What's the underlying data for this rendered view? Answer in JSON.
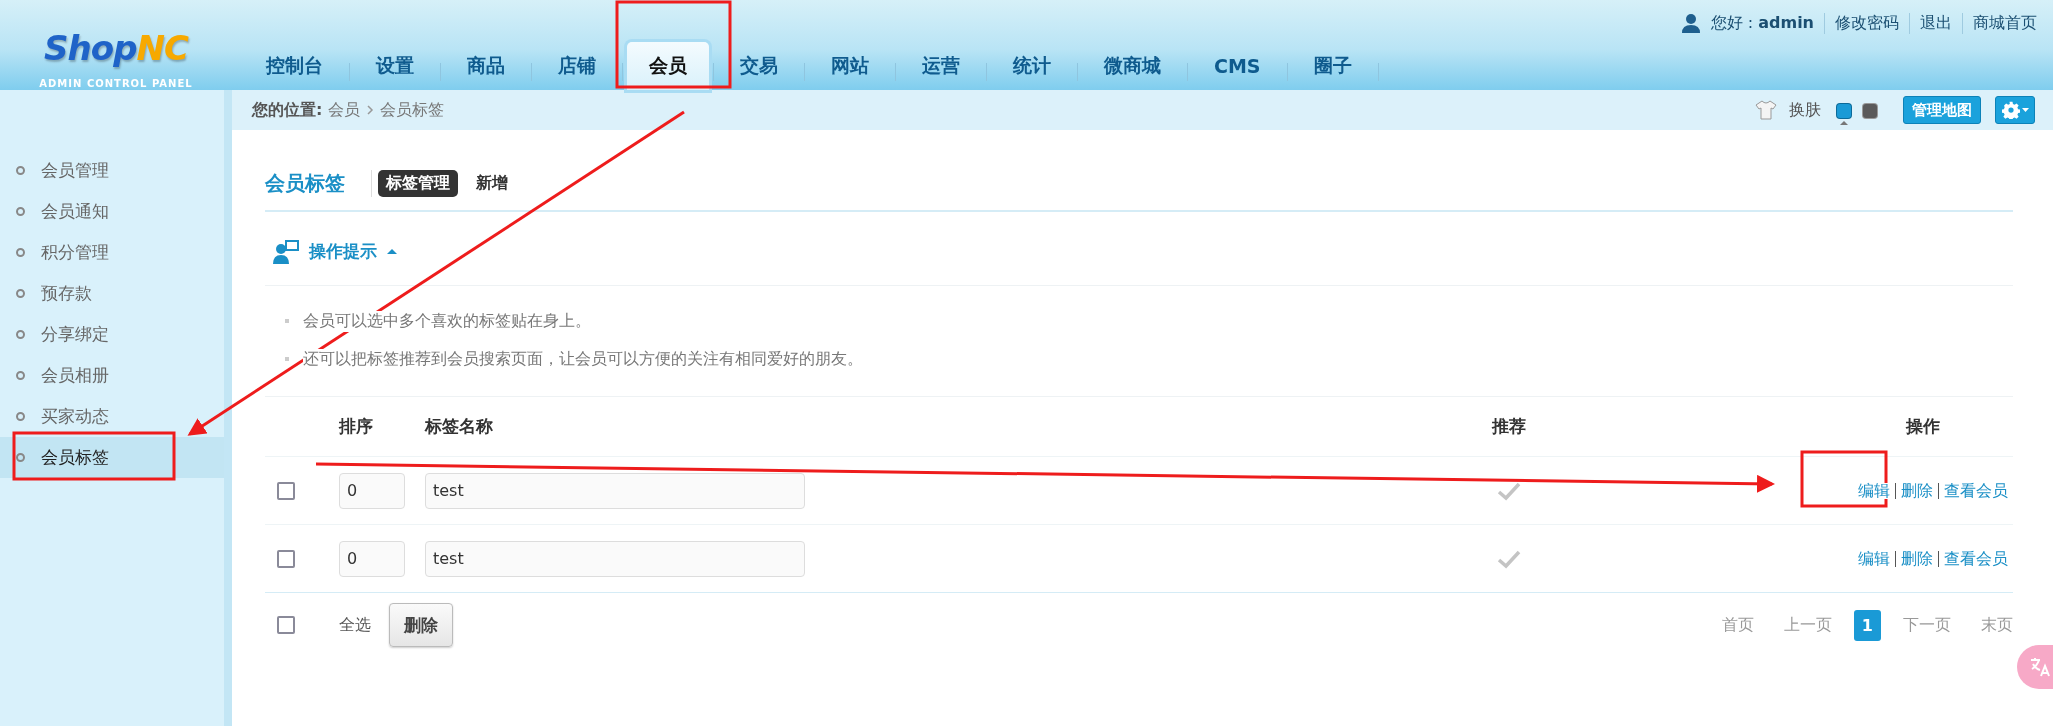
{
  "logo": {
    "brand_a": "Shop",
    "brand_b": "NC",
    "subtitle": "ADMIN CONTROL PANEL"
  },
  "nav_tabs": [
    {
      "label": "控制台",
      "selected": false
    },
    {
      "label": "设置",
      "selected": false
    },
    {
      "label": "商品",
      "selected": false
    },
    {
      "label": "店铺",
      "selected": false
    },
    {
      "label": "会员",
      "selected": true
    },
    {
      "label": "交易",
      "selected": false
    },
    {
      "label": "网站",
      "selected": false
    },
    {
      "label": "运营",
      "selected": false
    },
    {
      "label": "统计",
      "selected": false
    },
    {
      "label": "微商城",
      "selected": false
    },
    {
      "label": "CMS",
      "selected": false
    },
    {
      "label": "圈子",
      "selected": false
    }
  ],
  "user_bar": {
    "greeting": "您好 :",
    "username": "admin",
    "links": [
      "修改密码",
      "退出",
      "商城首页"
    ]
  },
  "breadcrumb": {
    "label": "您的位置:",
    "items": [
      "会员",
      "会员标签"
    ]
  },
  "toolbar": {
    "skin_label": "换肤",
    "skins": [
      {
        "color": "#1a9ad6",
        "selected": true
      },
      {
        "color": "#5a5a5a",
        "selected": false
      }
    ],
    "map_button": "管理地图"
  },
  "sidebar": {
    "items": [
      {
        "label": "会员管理",
        "selected": false
      },
      {
        "label": "会员通知",
        "selected": false
      },
      {
        "label": "积分管理",
        "selected": false
      },
      {
        "label": "预存款",
        "selected": false
      },
      {
        "label": "分享绑定",
        "selected": false
      },
      {
        "label": "会员相册",
        "selected": false
      },
      {
        "label": "买家动态",
        "selected": false
      },
      {
        "label": "会员标签",
        "selected": true
      }
    ]
  },
  "page": {
    "title": "会员标签",
    "tabs": [
      {
        "label": "标签管理",
        "selected": true
      },
      {
        "label": "新增",
        "selected": false
      }
    ]
  },
  "tips": {
    "title": "操作提示",
    "expanded": true,
    "lines": [
      "会员可以选中多个喜欢的标签贴在身上。",
      "还可以把标签推荐到会员搜索页面，让会员可以方便的关注有相同爱好的朋友。"
    ]
  },
  "table": {
    "columns": [
      "排序",
      "标签名称",
      "推荐",
      "操作"
    ],
    "rows": [
      {
        "checked": false,
        "sort": "0",
        "name": "test",
        "recommended": true,
        "actions": [
          "编辑",
          "删除",
          "查看会员"
        ]
      },
      {
        "checked": false,
        "sort": "0",
        "name": "test",
        "recommended": true,
        "actions": [
          "编辑",
          "删除",
          "查看会员"
        ]
      }
    ]
  },
  "footer": {
    "checked": false,
    "select_all": "全选",
    "delete_button": "删除"
  },
  "pagination": [
    {
      "label": "首页",
      "selected": false
    },
    {
      "label": "上一页",
      "selected": false
    },
    {
      "label": "1",
      "selected": true
    },
    {
      "label": "下一页",
      "selected": false
    },
    {
      "label": "末页",
      "selected": false
    }
  ]
}
